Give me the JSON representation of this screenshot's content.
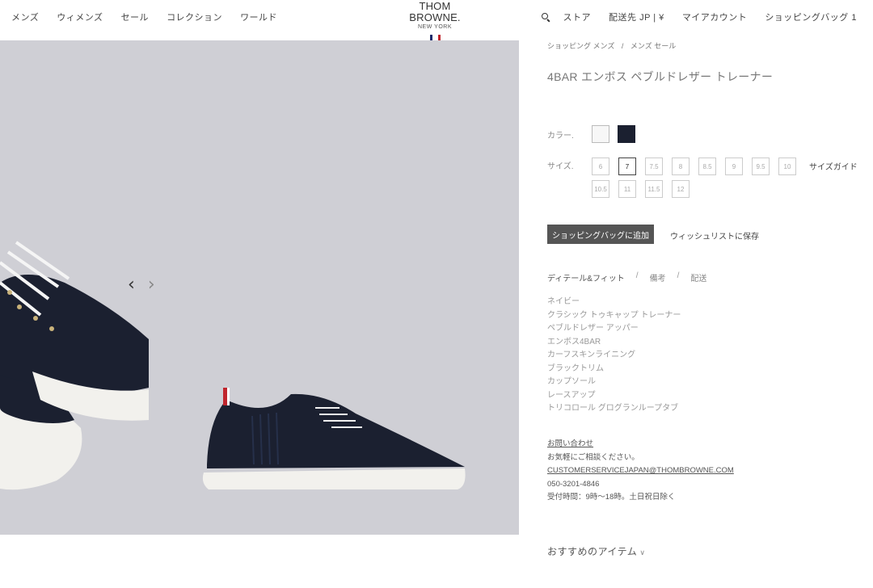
{
  "header": {
    "nav_left": [
      "メンズ",
      "ウィメンズ",
      "セール",
      "コレクション",
      "ワールド"
    ],
    "brand": "THOM BROWNE.",
    "city": "NEW YORK",
    "flag_colors": [
      "#1b2a6b",
      "#ffffff",
      "#c0252d"
    ],
    "store": "ストア",
    "ship_to": "配送先 JP | ¥",
    "account": "マイアカウント",
    "bag": "ショッピングバッグ 1"
  },
  "gallery": {
    "prev": "‹",
    "next": "›",
    "colors": {
      "background": "#cfcfd5",
      "shoe": "#1b2030",
      "sole": "#f2f1ed"
    }
  },
  "product": {
    "breadcrumb": [
      "ショッピング メンズ",
      "/",
      "メンズ セール"
    ],
    "title": "4BAR エンボス ペブルドレザー トレーナー",
    "color_label": "カラー.",
    "colors": [
      "#f7f7f7",
      "#1b2030"
    ],
    "size_label": "サイズ.",
    "sizes": [
      "6",
      "7",
      "7.5",
      "8",
      "8.5",
      "9",
      "9.5",
      "10",
      "10.5",
      "11",
      "11.5",
      "12"
    ],
    "selected_size": "7",
    "size_guide": "サイズガイド",
    "add_to_bag": "ショッピングバッグに追加",
    "wishlist": "ウィッシュリストに保存",
    "tabs": [
      "ディテール&フィット",
      "備考",
      "配送"
    ],
    "tab_separator": "/",
    "details": [
      "ネイビー",
      "クラシック トゥキャップ トレーナー",
      "ペブルドレザー アッパー",
      "エンボス4BAR",
      "カーフスキンライニング",
      "ブラックトリム",
      "カップソール",
      "レースアップ",
      "トリコロール グログランループタブ"
    ],
    "contact": {
      "title": "お問い合わせ",
      "line1": "お気軽にご相談ください。",
      "email": "CUSTOMERSERVICEJAPAN@THOMBROWNE.COM",
      "phone": "050-3201-4846",
      "hours": "受付時間：9時〜18時。土日祝日除く"
    },
    "recommended": "おすすめのアイテム",
    "recommended_chevron": "∨"
  }
}
